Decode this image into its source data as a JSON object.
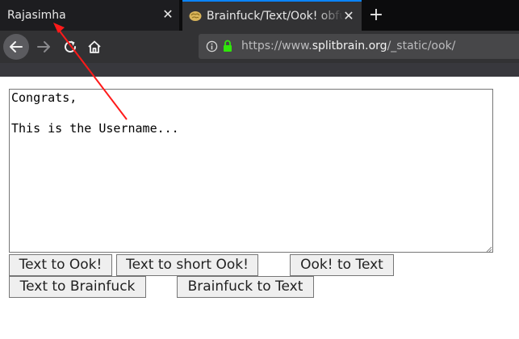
{
  "browser": {
    "tabs": [
      {
        "title": "Rajasimha",
        "active": false
      },
      {
        "title": "Brainfuck/Text/Ook! obfuscator - deobfuscator",
        "active": true,
        "favicon": "brain-icon"
      }
    ],
    "new_tab_icon": "plus-icon",
    "nav": {
      "back_icon": "back-arrow-icon",
      "forward_icon": "forward-arrow-icon",
      "reload_icon": "reload-icon",
      "home_icon": "home-icon"
    },
    "url": {
      "scheme": "https://www.",
      "host": "splitbrain.org",
      "path": "/_static/ook/",
      "lock_color": "#30e60b"
    },
    "accent_color": "#0a84ff"
  },
  "page": {
    "textarea_value": "Congrats,\n\nThis is the Username...",
    "buttons": {
      "text_to_ook": "Text to Ook!",
      "text_to_short_ook": "Text to short Ook!",
      "ook_to_text": "Ook! to Text",
      "text_to_brainfuck": "Text to Brainfuck",
      "brainfuck_to_text": "Brainfuck to Text"
    }
  },
  "annotation": {
    "type": "arrow",
    "color": "#ff1a1a",
    "points_to": "tab-rajasimha"
  }
}
